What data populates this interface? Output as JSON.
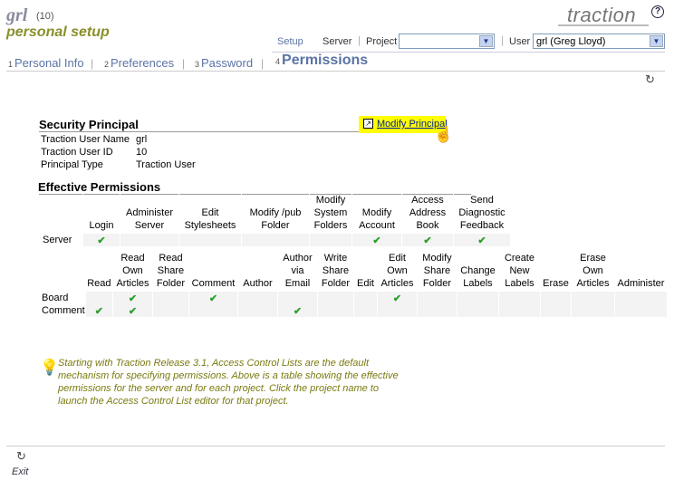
{
  "header": {
    "user_login": "grl",
    "user_count": "(10)",
    "page_heading": "personal setup",
    "brand": "traction",
    "help_icon": "?"
  },
  "nav": {
    "setup": "Setup",
    "server": "Server",
    "project_label": "Project",
    "project_value": "",
    "user_label": "User",
    "user_value": "grl (Greg Lloyd)"
  },
  "tabs": [
    {
      "num": "1",
      "label": "Personal Info"
    },
    {
      "num": "2",
      "label": "Preferences"
    },
    {
      "num": "3",
      "label": "Password"
    },
    {
      "num": "4",
      "label": "Permissions"
    }
  ],
  "principal": {
    "title": "Security Principal",
    "modify_button": "Modify Principal",
    "fields": [
      {
        "label": "Traction User Name",
        "value": "grl"
      },
      {
        "label": "Traction User ID",
        "value": "10"
      },
      {
        "label": "Principal Type",
        "value": "Traction User"
      }
    ]
  },
  "permissions": {
    "title": "Effective Permissions",
    "server_columns": [
      "Login",
      "Administer Server",
      "Edit Stylesheets",
      "Modify /pub Folder",
      "Modify System Folders",
      "Modify Account",
      "Access Address Book",
      "Send Diagnostic Feedback"
    ],
    "server_rows": [
      {
        "label": "Server",
        "checks": [
          true,
          false,
          false,
          false,
          false,
          true,
          true,
          true
        ]
      }
    ],
    "project_columns": [
      "Read",
      "Read Own Articles",
      "Read Share Folder",
      "Comment",
      "Author",
      "Author via Email",
      "Write Share Folder",
      "Edit",
      "Edit Own Articles",
      "Modify Share Folder",
      "Change Labels",
      "Create New Labels",
      "Erase",
      "Erase Own Articles",
      "Administer"
    ],
    "project_rows": [
      {
        "label": "Board",
        "checks": [
          false,
          true,
          false,
          true,
          false,
          false,
          false,
          false,
          true,
          false,
          false,
          false,
          false,
          false,
          false
        ]
      },
      {
        "label": "Comment",
        "checks": [
          true,
          true,
          false,
          false,
          false,
          true,
          false,
          false,
          false,
          false,
          false,
          false,
          false,
          false,
          false
        ]
      }
    ],
    "check_symbol": "✔"
  },
  "tip": {
    "text": "Starting with Traction Release 3.1, Access Control Lists are the default mechanism for specifying permissions. Above is a table showing the effective permissions for the server and for each project. Click the project name to launch the Access Control List editor for that project."
  },
  "footer": {
    "exit_label": "Exit"
  },
  "colors": {
    "accent": "#5b74a6",
    "heading_olive": "#8a8f2a",
    "highlight": "#ffff00",
    "check": "#2aa02a"
  }
}
